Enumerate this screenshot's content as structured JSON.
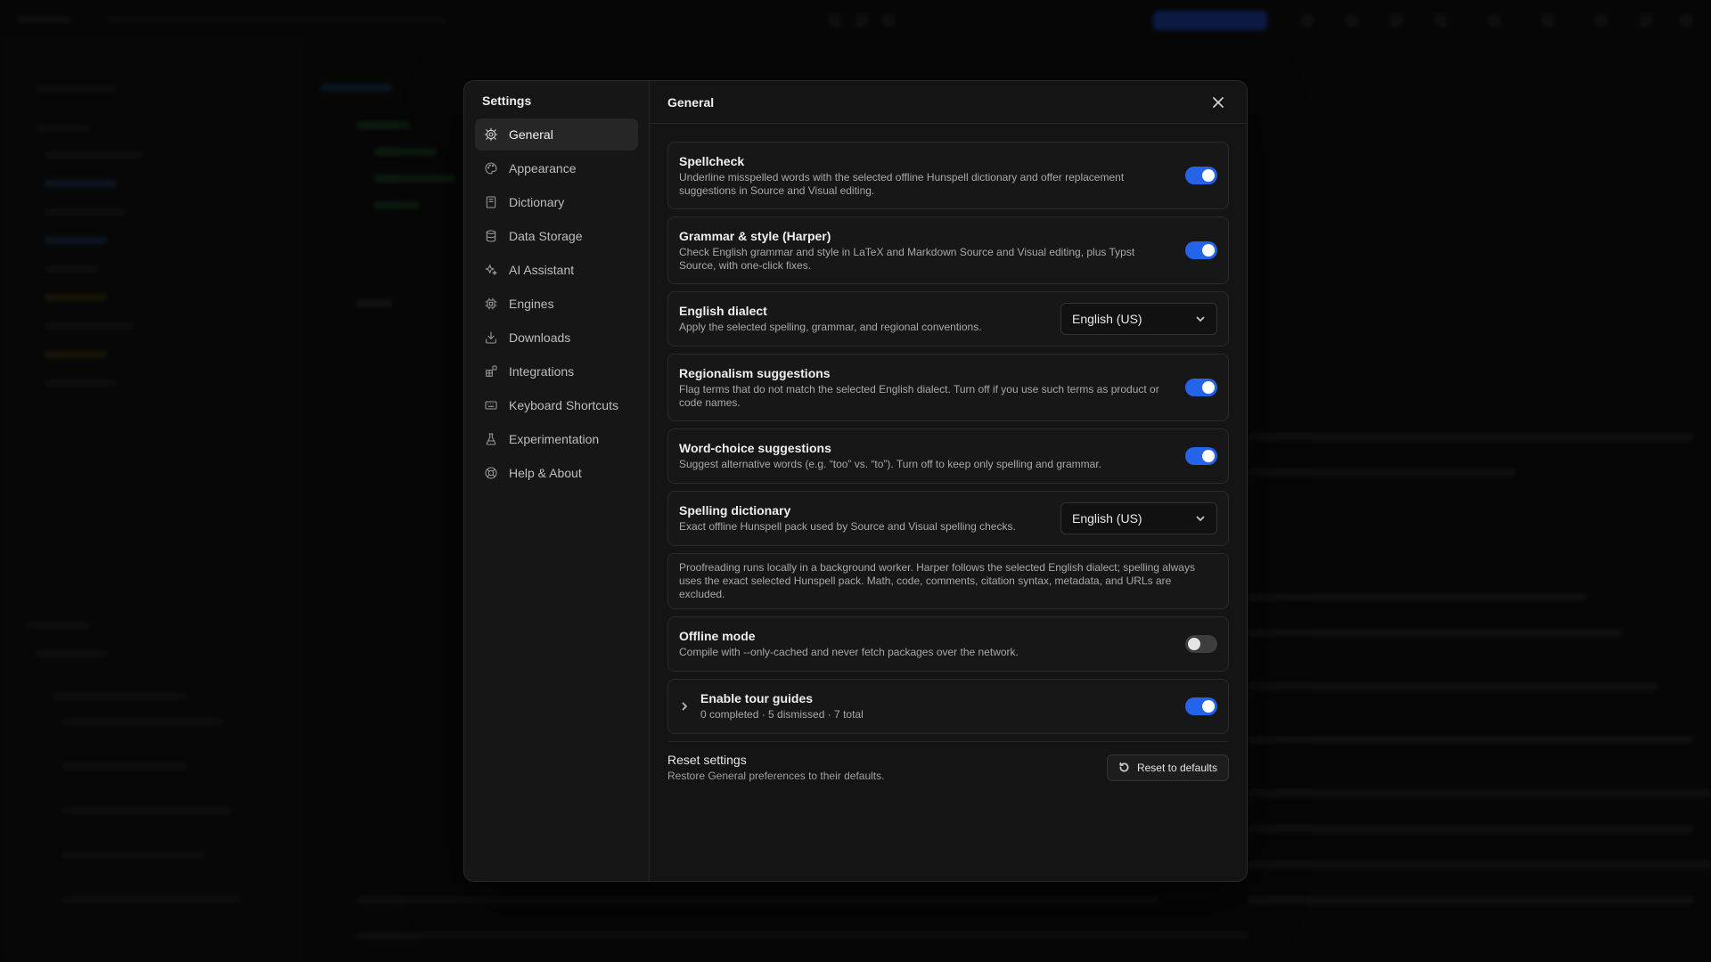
{
  "settings": {
    "title": "Settings",
    "nav": [
      {
        "label": "General",
        "icon": "gear-icon",
        "active": true
      },
      {
        "label": "Appearance",
        "icon": "palette-icon"
      },
      {
        "label": "Dictionary",
        "icon": "book-icon"
      },
      {
        "label": "Data Storage",
        "icon": "database-icon"
      },
      {
        "label": "AI Assistant",
        "icon": "sparkles-icon"
      },
      {
        "label": "Engines",
        "icon": "cpu-icon"
      },
      {
        "label": "Downloads",
        "icon": "download-icon"
      },
      {
        "label": "Integrations",
        "icon": "blocks-icon"
      },
      {
        "label": "Keyboard Shortcuts",
        "icon": "keyboard-icon"
      },
      {
        "label": "Experimentation",
        "icon": "flask-icon"
      },
      {
        "label": "Help & About",
        "icon": "lifebuoy-icon"
      }
    ]
  },
  "general": {
    "title": "General",
    "spellcheck": {
      "title": "Spellcheck",
      "desc": "Underline misspelled words with the selected offline Hunspell dictionary and offer replacement suggestions in Source and Visual editing.",
      "enabled": true
    },
    "grammar": {
      "title": "Grammar & style (Harper)",
      "desc": "Check English grammar and style in LaTeX and Markdown Source and Visual editing, plus Typst Source, with one-click fixes.",
      "enabled": true
    },
    "dialect": {
      "title": "English dialect",
      "desc": "Apply the selected spelling, grammar, and regional conventions.",
      "value": "English (US)"
    },
    "regionalism": {
      "title": "Regionalism suggestions",
      "desc": "Flag terms that do not match the selected English dialect. Turn off if you use such terms as product or code names.",
      "enabled": true
    },
    "wordchoice": {
      "title": "Word-choice suggestions",
      "desc": "Suggest alternative words (e.g. “too” vs. “to”). Turn off to keep only spelling and grammar.",
      "enabled": true
    },
    "dictionary": {
      "title": "Spelling dictionary",
      "desc": "Exact offline Hunspell pack used by Source and Visual spelling checks.",
      "value": "English (US)"
    },
    "info": "Proofreading runs locally in a background worker. Harper follows the selected English dialect; spelling always uses the exact selected Hunspell pack. Math, code, comments, citation syntax, metadata, and URLs are excluded.",
    "offline": {
      "title": "Offline mode",
      "desc": "Compile with --only-cached and never fetch packages over the network.",
      "enabled": false
    },
    "tour": {
      "title": "Enable tour guides",
      "desc": "0 completed · 5 dismissed · 7 total",
      "enabled": true
    },
    "reset": {
      "title": "Reset settings",
      "desc": "Restore General preferences to their defaults.",
      "button": "Reset to defaults"
    }
  },
  "colors": {
    "accent": "#2563eb",
    "modal_bg": "#141414",
    "card_bg": "#171717"
  }
}
